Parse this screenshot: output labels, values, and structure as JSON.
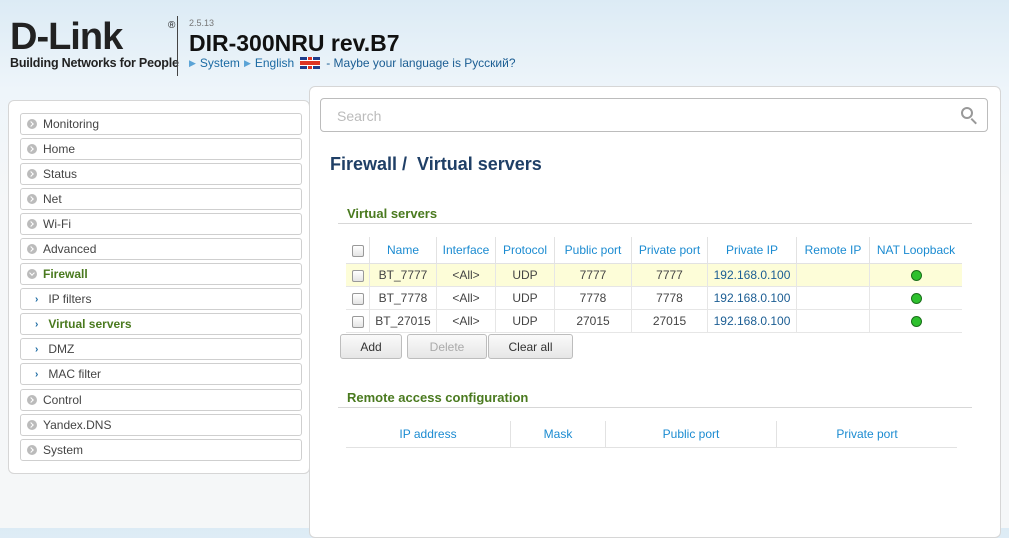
{
  "brand": {
    "logo": "D-Link",
    "registered": "®",
    "tagline": "Building Networks for People"
  },
  "header": {
    "version": "2.5.13",
    "model": "DIR-300NRU rev.B7",
    "system_link": "System",
    "language": "English",
    "language_prompt": "- Maybe your language is Русский?"
  },
  "search": {
    "placeholder": "Search"
  },
  "sidebar": {
    "items": [
      {
        "label": "Monitoring"
      },
      {
        "label": "Home"
      },
      {
        "label": "Status"
      },
      {
        "label": "Net"
      },
      {
        "label": "Wi-Fi"
      },
      {
        "label": "Advanced"
      },
      {
        "label": "Firewall"
      },
      {
        "label": "IP filters"
      },
      {
        "label": "Virtual servers"
      },
      {
        "label": "DMZ"
      },
      {
        "label": "MAC filter"
      },
      {
        "label": "Control"
      },
      {
        "label": "Yandex.DNS"
      },
      {
        "label": "System"
      }
    ]
  },
  "page": {
    "breadcrumb_parent": "Firewall /",
    "breadcrumb_current": "Virtual servers"
  },
  "virtual_servers": {
    "title": "Virtual servers",
    "columns": [
      "Name",
      "Interface",
      "Protocol",
      "Public port",
      "Private port",
      "Private IP",
      "Remote IP",
      "NAT Loopback"
    ],
    "rows": [
      {
        "name": "BT_7777",
        "interface": "<All>",
        "protocol": "UDP",
        "public_port": "7777",
        "private_port": "7777",
        "private_ip": "192.168.0.100",
        "remote_ip": "",
        "nat_loopback": "enabled"
      },
      {
        "name": "BT_7778",
        "interface": "<All>",
        "protocol": "UDP",
        "public_port": "7778",
        "private_port": "7778",
        "private_ip": "192.168.0.100",
        "remote_ip": "",
        "nat_loopback": "enabled"
      },
      {
        "name": "BT_27015",
        "interface": "<All>",
        "protocol": "UDP",
        "public_port": "27015",
        "private_port": "27015",
        "private_ip": "192.168.0.100",
        "remote_ip": "",
        "nat_loopback": "enabled"
      }
    ],
    "buttons": {
      "add": "Add",
      "delete": "Delete",
      "clear_all": "Clear all"
    }
  },
  "remote_access": {
    "title": "Remote access configuration",
    "columns": [
      "IP address",
      "Mask",
      "Public port",
      "Private port"
    ]
  },
  "colors": {
    "section_green": "#4a7a1f",
    "header_blue": "#1b8bd1",
    "title_navy": "#1f3f66",
    "status_green": "#2ec12e"
  }
}
